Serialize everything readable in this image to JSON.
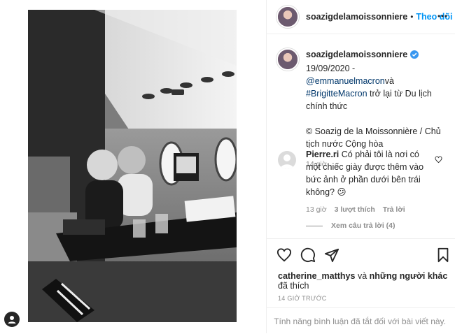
{
  "header": {
    "username": "soazigdelamoissonniere",
    "dot": "•",
    "follow_label": "Theo dõi"
  },
  "caption": {
    "username": "soazigdelamoissonniere",
    "date_text": "19/09/2020 - ",
    "mention": "@emmanuelmacron",
    "mention_suffix": "và",
    "hashtag": "#BrigitteMacron",
    "body": " trở lại từ Du lịch chính thức",
    "credit": "© Soazig de la Moissonnière / Chủ tịch nước Cộng hòa",
    "time": "14 giờ"
  },
  "comment": {
    "username": "Pierre.ri",
    "text": " Có phải tôi là nơi có một chiếc giày được thêm vào bức ảnh ở phần dưới bên trái không? ",
    "emoji": "😕",
    "time": "13 giờ",
    "likes": "3 lượt thích",
    "reply": "Trả lời",
    "view_replies": "Xem câu trả lời (4)"
  },
  "actions": {
    "liked_by_user": "catherine_matthys",
    "liked_by_and": " và ",
    "liked_by_others": "những người khác",
    "liked_suffix": "đã thích",
    "timestamp": "14 GIỜ TRƯỚC",
    "comments_disabled": "Tính năng bình luận đã tắt đối với bài viết này."
  },
  "colors": {
    "accent": "#0095f6",
    "verified": "#3897f0",
    "muted": "#8e8e8e",
    "border": "#efefef"
  },
  "icons": [
    "more-options-icon",
    "verified-badge-icon",
    "heart-icon",
    "comment-icon",
    "share-icon",
    "bookmark-icon",
    "user-icon"
  ]
}
